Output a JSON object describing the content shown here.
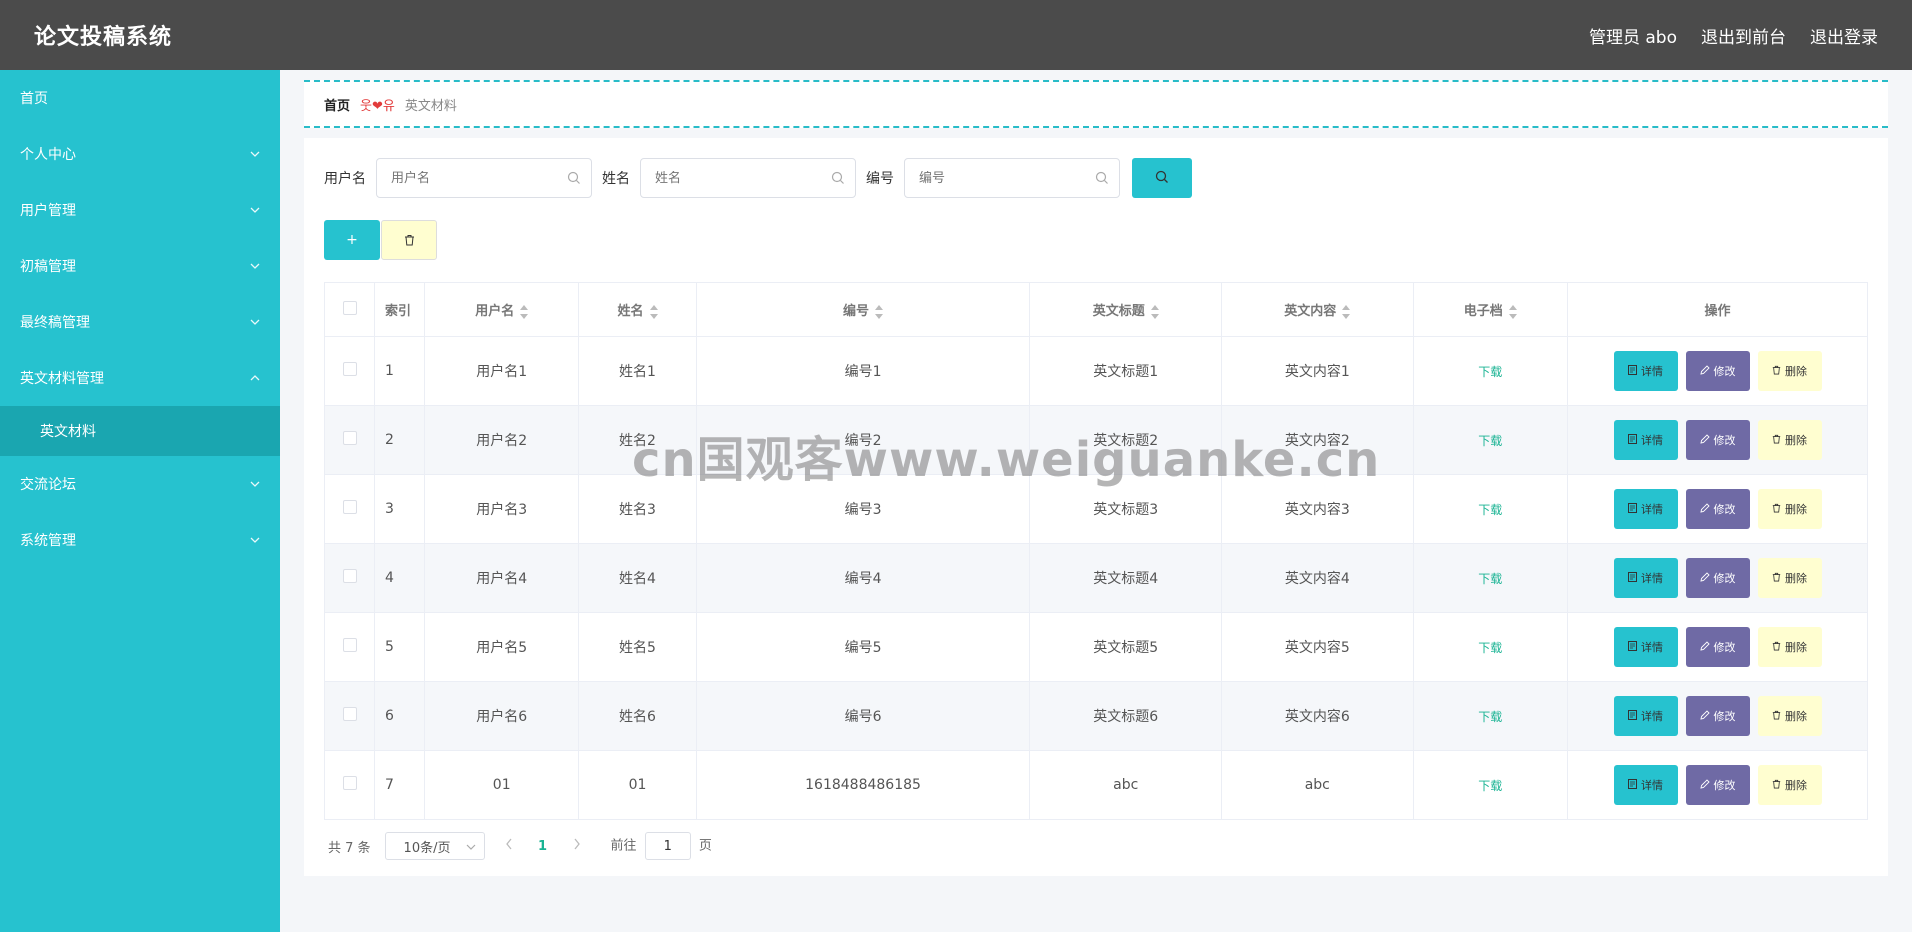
{
  "header": {
    "brand": "论文投稿系统",
    "admin_label": "管理员 abo",
    "back_front": "退出到前台",
    "logout": "退出登录"
  },
  "sidebar": {
    "items": [
      {
        "label": "首页",
        "has_chevron": false
      },
      {
        "label": "个人中心",
        "has_chevron": true,
        "chevron": "down"
      },
      {
        "label": "用户管理",
        "has_chevron": true,
        "chevron": "down"
      },
      {
        "label": "初稿管理",
        "has_chevron": true,
        "chevron": "down"
      },
      {
        "label": "最终稿管理",
        "has_chevron": true,
        "chevron": "down"
      },
      {
        "label": "英文材料管理",
        "has_chevron": true,
        "chevron": "up"
      },
      {
        "label": "交流论坛",
        "has_chevron": true,
        "chevron": "down"
      },
      {
        "label": "系统管理",
        "has_chevron": true,
        "chevron": "down"
      }
    ],
    "active_sub": "英文材料"
  },
  "breadcrumb": {
    "home": "首页",
    "separator": "웃❤유",
    "current": "英文材料"
  },
  "search": {
    "username_label": "用户名",
    "username_placeholder": "用户名",
    "name_label": "姓名",
    "name_placeholder": "姓名",
    "number_label": "编号",
    "number_placeholder": "编号"
  },
  "actions": {
    "add": "+"
  },
  "table": {
    "headers": {
      "index": "索引",
      "username": "用户名",
      "name": "姓名",
      "number": "编号",
      "en_title": "英文标题",
      "en_content": "英文内容",
      "file": "电子档",
      "ops": "操作"
    },
    "rows": [
      {
        "index": "1",
        "username": "用户名1",
        "name": "姓名1",
        "number": "编号1",
        "en_title": "英文标题1",
        "en_content": "英文内容1",
        "file": "下载"
      },
      {
        "index": "2",
        "username": "用户名2",
        "name": "姓名2",
        "number": "编号2",
        "en_title": "英文标题2",
        "en_content": "英文内容2",
        "file": "下载"
      },
      {
        "index": "3",
        "username": "用户名3",
        "name": "姓名3",
        "number": "编号3",
        "en_title": "英文标题3",
        "en_content": "英文内容3",
        "file": "下载"
      },
      {
        "index": "4",
        "username": "用户名4",
        "name": "姓名4",
        "number": "编号4",
        "en_title": "英文标题4",
        "en_content": "英文内容4",
        "file": "下载"
      },
      {
        "index": "5",
        "username": "用户名5",
        "name": "姓名5",
        "number": "编号5",
        "en_title": "英文标题5",
        "en_content": "英文内容5",
        "file": "下载"
      },
      {
        "index": "6",
        "username": "用户名6",
        "name": "姓名6",
        "number": "编号6",
        "en_title": "英文标题6",
        "en_content": "英文内容6",
        "file": "下载"
      },
      {
        "index": "7",
        "username": "01",
        "name": "01",
        "number": "1618488486185",
        "en_title": "abc",
        "en_content": "abc",
        "file": "下载"
      }
    ],
    "op_labels": {
      "detail": "详情",
      "edit": "修改",
      "delete": "删除"
    }
  },
  "pagination": {
    "total": "共 7 条",
    "page_size": "10条/页",
    "current_page": "1",
    "goto_prefix": "前往",
    "goto_value": "1",
    "goto_suffix": "页"
  },
  "watermark": "cn国观客www.weiguanke.cn",
  "colors": {
    "header_bg": "#4b4b4b",
    "sidebar_bg": "#26c2cf",
    "sidebar_active_bg": "#1aa6b0",
    "primary": "#26c2cf",
    "edit": "#6f6aa5",
    "delete": "#fffed0",
    "download": "#19b393"
  }
}
